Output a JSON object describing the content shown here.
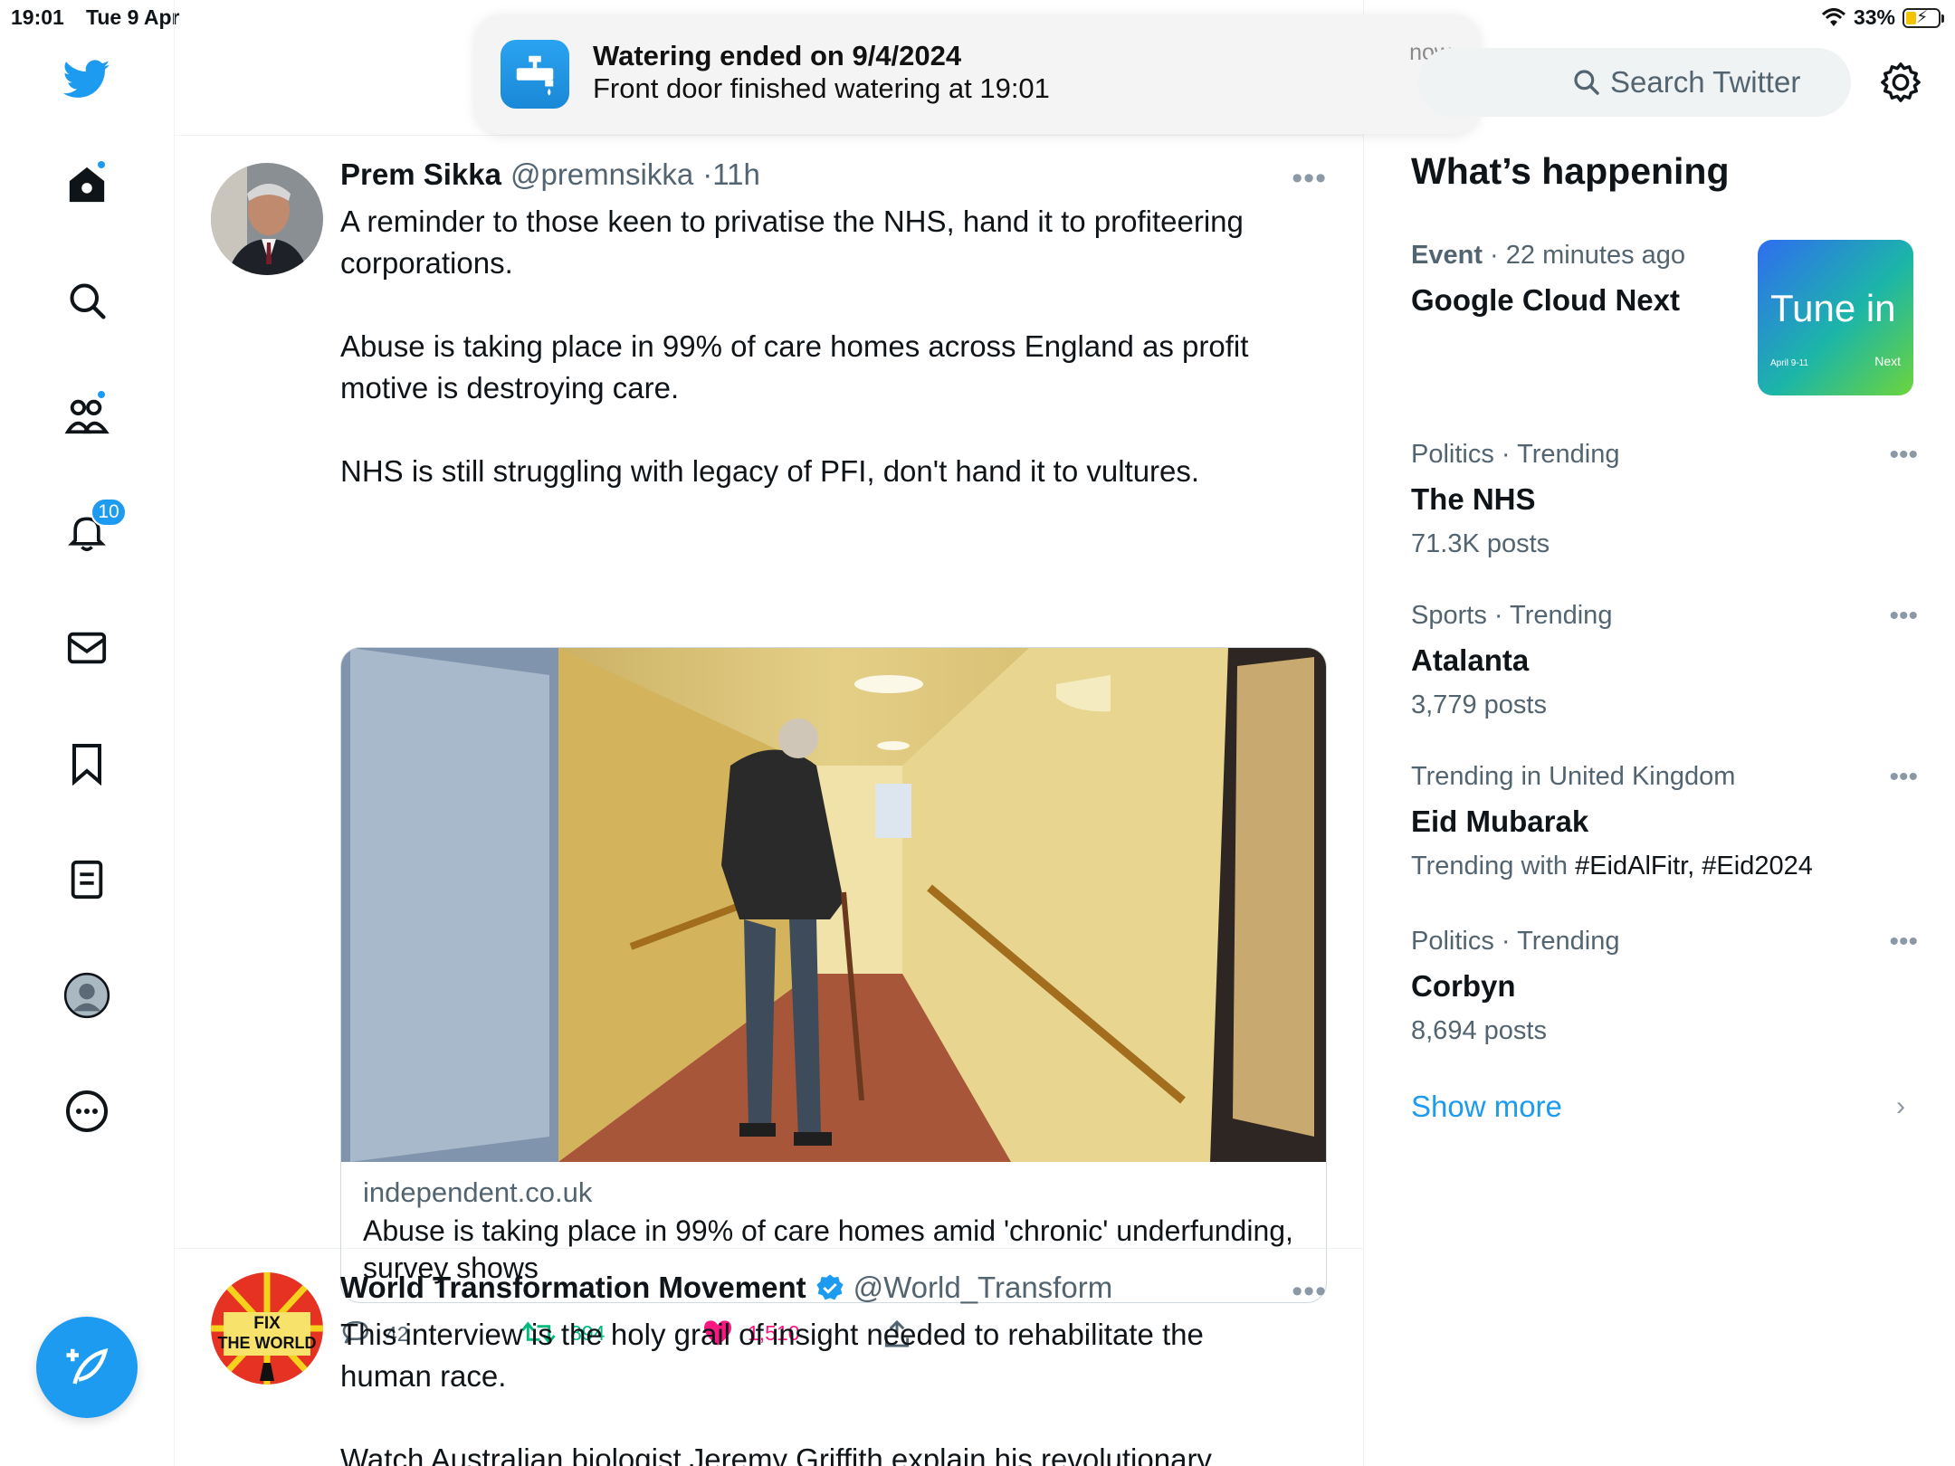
{
  "status_bar": {
    "time": "19:01",
    "date": "Tue 9 Apr",
    "battery": "33%",
    "battery_level": 0.33
  },
  "notification": {
    "title": "Watering ended on 9/4/2024",
    "body": "Front door finished watering at 19:01",
    "time": "now"
  },
  "sidebar": {
    "notifications_count": "10",
    "items": [
      "twitter-logo",
      "home-icon",
      "search-icon",
      "communities-icon",
      "bell-icon",
      "mail-icon",
      "bookmark-icon",
      "lists-icon",
      "profile-icon",
      "more-icon"
    ]
  },
  "search": {
    "placeholder": "Search Twitter"
  },
  "tweets": [
    {
      "name": "Prem Sikka",
      "handle": "@premnsikka",
      "time": "11h",
      "paragraphs": [
        "A reminder to those keen to privatise the NHS, hand it to profiteering corporations.",
        "Abuse is taking place in 99% of care homes across England as profit motive is destroying care.",
        "NHS is still struggling with legacy of PFI, don't hand it to vultures."
      ],
      "card": {
        "domain": "independent.co.uk",
        "title": "Abuse is taking place in 99% of care homes amid 'chronic' underfunding, survey shows"
      },
      "replies": "42",
      "retweets": "894",
      "likes": "1,510"
    },
    {
      "name": "World Transformation Movement",
      "handle": "@World_Transform",
      "avatar_text": [
        "FIX",
        "THE WORLD"
      ],
      "paragraphs": [
        "This interview is the holy grail of insight needed to rehabilitate the human race.",
        "Watch Australian biologist Jeremy Griffith explain his revolutionary"
      ]
    }
  ],
  "whats_happening": {
    "title": "What’s happening",
    "event": {
      "category": "Event",
      "time": "22 minutes ago",
      "title": "Google Cloud Next",
      "thumb_text": "Tune in",
      "thumb_date": "April 9-11",
      "thumb_brand": "Next"
    },
    "trends": [
      {
        "meta": "Politics · Trending",
        "title": "The NHS",
        "sub": "71.3K posts"
      },
      {
        "meta": "Sports · Trending",
        "title": "Atalanta",
        "sub": "3,779 posts"
      },
      {
        "meta": "Trending in United Kingdom",
        "title": "Eid Mubarak",
        "sub_prefix": "Trending with",
        "sub_tags": "#EidAlFitr, #Eid2024"
      },
      {
        "meta": "Politics · Trending",
        "title": "Corbyn",
        "sub": "8,694 posts"
      }
    ],
    "show_more": "Show more"
  },
  "colors": {
    "accent": "#1d9bf0",
    "like": "#f91880",
    "retweet": "#00ba7c"
  }
}
